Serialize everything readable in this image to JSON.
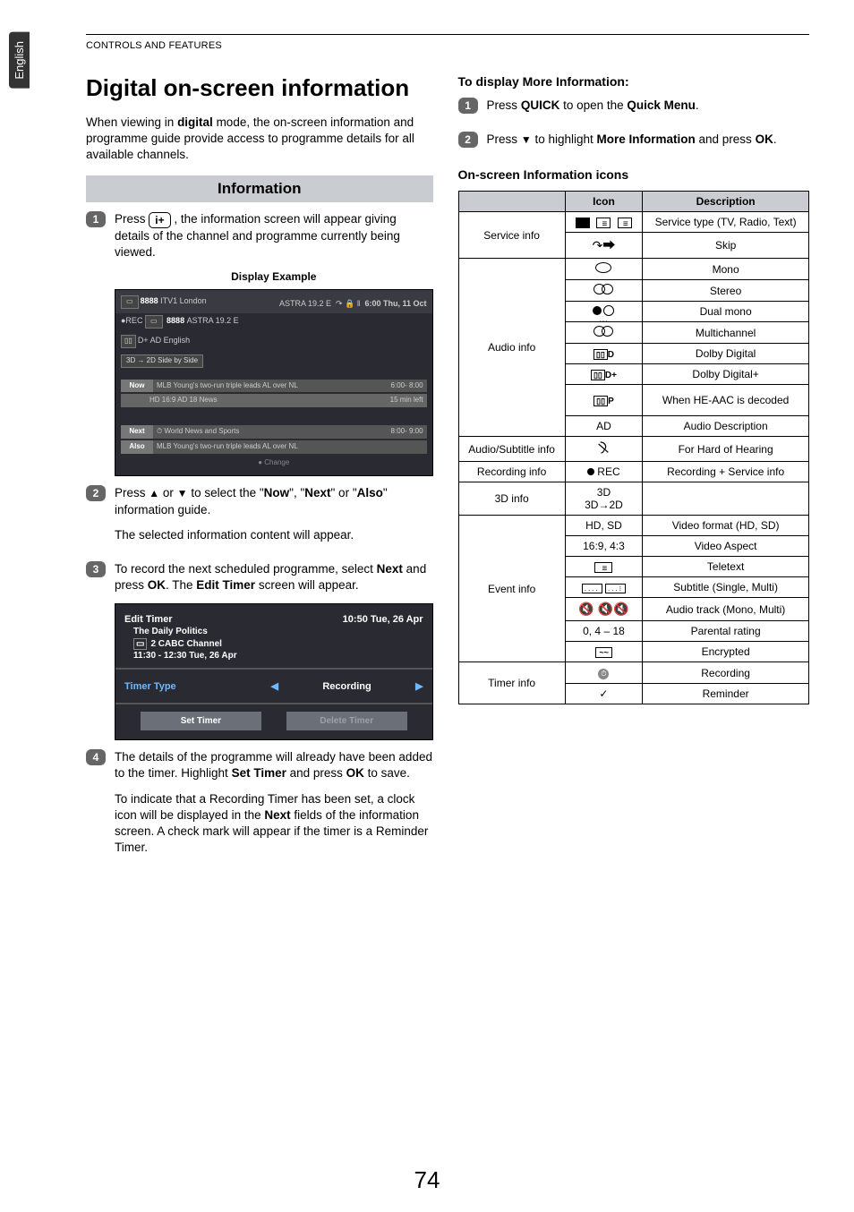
{
  "header": {
    "section": "CONTROLS AND FEATURES",
    "lang_tab": "English"
  },
  "left": {
    "h1": "Digital on-screen information",
    "intro": "When viewing in digital mode, the on-screen information and programme guide provide access to programme details for all available channels.",
    "info_title": "Information",
    "step1_a": "Press ",
    "step1_b": " , the information screen will appear giving details of the channel and programme currently being viewed.",
    "iplus_label": "i+",
    "display_caption": "Display Example",
    "display": {
      "ch_num": "8888",
      "ch_name": "ITV1 London",
      "sat": "ASTRA 19.2 E",
      "clock": "6:00 Thu, 11 Oct",
      "rec_ch": "8888",
      "rec_sat": "ASTRA 19.2 E",
      "rec_tag": "●REC",
      "audio_box": "D+   AD English",
      "mode_row": "3D → 2D   Side by Side",
      "now_tag": "Now",
      "now_text": "MLB Young's two-run triple leads AL over NL",
      "now_time": "6:00- 8:00",
      "now_meta": "HD  16:9   AD  18   News",
      "now_left": "15 min left",
      "next_tag": "Next",
      "next_text": "World News and Sports",
      "next_time": "8:00- 9:00",
      "also_tag": "Also",
      "also_text": "MLB Young's two-run triple leads AL over NL",
      "change": "Change"
    },
    "step2_a": "Press ",
    "step2_b": " or ",
    "step2_c": " to select the \"",
    "step2_now": "Now",
    "step2_mid1": "\", \"",
    "step2_next": "Next",
    "step2_mid2": "\" or \"",
    "step2_also": "Also",
    "step2_end": "\" information guide.",
    "step2_p2": "The selected information content will appear.",
    "step3_a": "To record the next scheduled programme, select ",
    "step3_next": "Next",
    "step3_b": " and press ",
    "step3_ok": "OK",
    "step3_c": ". The ",
    "step3_et": "Edit Timer",
    "step3_d": " screen will appear.",
    "edit_timer": {
      "title": "Edit Timer",
      "clock": "10:50 Tue, 26 Apr",
      "prog": "The Daily Politics",
      "chan": "2 CABC Channel",
      "time": "11:30 - 12:30 Tue, 26 Apr",
      "tt_label": "Timer Type",
      "tt_val": "Recording",
      "set": "Set Timer",
      "del": "Delete Timer"
    },
    "step4_a": "The details of the programme will already have been added to the timer. Highlight ",
    "step4_set": "Set Timer",
    "step4_b": " and press ",
    "step4_ok": "OK",
    "step4_c": " to save.",
    "step4_p2_a": "To indicate that a Recording Timer has been set, a clock icon will be displayed in the ",
    "step4_p2_next": "Next",
    "step4_p2_b": " fields of the information screen. A check mark will appear if the timer is a Reminder Timer."
  },
  "right": {
    "more_title": "To display More Information:",
    "r1_a": "Press ",
    "r1_quick": "QUICK",
    "r1_b": " to open the ",
    "r1_qm": "Quick Menu",
    "r1_c": ".",
    "r2_a": "Press ",
    "r2_b": " to highlight ",
    "r2_mi": "More Information",
    "r2_c": " and press ",
    "r2_ok": "OK",
    "r2_d": ".",
    "icons_title": "On-screen Information icons",
    "th_icon": "Icon",
    "th_desc": "Description",
    "rows": {
      "service_info": "Service info",
      "service_type": "Service type (TV, Radio, Text)",
      "skip": "Skip",
      "audio_info": "Audio info",
      "mono": "Mono",
      "stereo": "Stereo",
      "dual": "Dual mono",
      "multi": "Multichannel",
      "dd": "Dolby Digital",
      "ddp": "Dolby Digital+",
      "heaac": "When HE-AAC is decoded",
      "ad_label": "AD",
      "ad_desc": "Audio Description",
      "audsub": "Audio/Subtitle info",
      "hoh": "For Hard of Hearing",
      "recinfo": "Recording info",
      "rec_icon": "REC",
      "rec_desc": "Recording + Service info",
      "d3info": "3D info",
      "d3_a": "3D",
      "d3_b": "3D→2D",
      "eventinfo": "Event info",
      "hdsd": "HD, SD",
      "vformat": "Video format (HD, SD)",
      "aspect": "16:9, 4:3",
      "vaspect": "Video Aspect",
      "teletext": "Teletext",
      "subdesc": "Subtitle (Single, Multi)",
      "audtrack": "Audio track (Mono, Multi)",
      "parental_val": "0, 4 – 18",
      "parental": "Parental rating",
      "enc": "Encrypted",
      "timerinfo": "Timer info",
      "recording": "Recording",
      "reminder": "Reminder",
      "enc_glyph": "~~",
      "p_glyph": "P",
      "dplus_glyph": "D+",
      "d_glyph": "D"
    }
  },
  "page_number": "74"
}
